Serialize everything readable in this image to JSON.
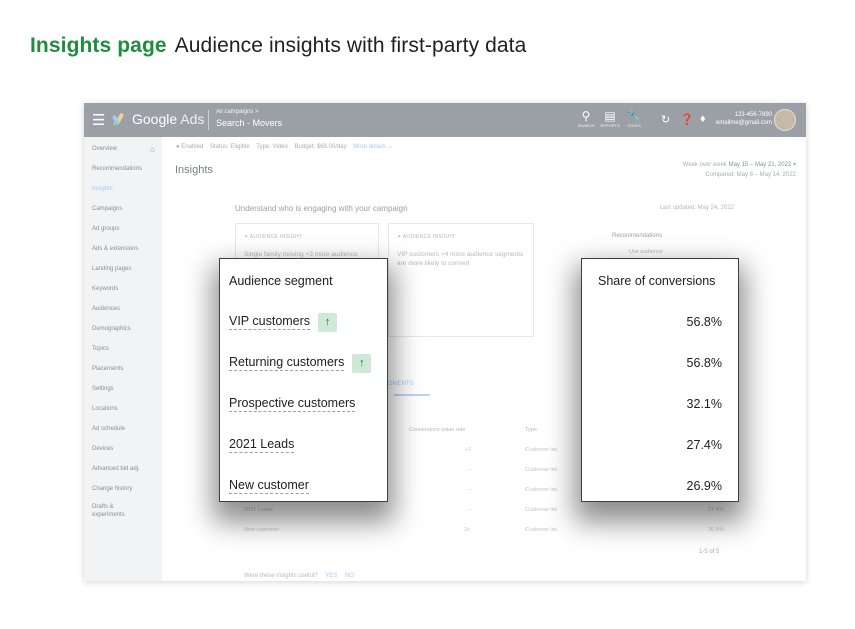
{
  "headline": {
    "title": "Insights page",
    "subtitle": "Audience insights with first-party data"
  },
  "topbar": {
    "brand_google": "Google",
    "brand_ads": "Ads",
    "breadcrumb": "All campaigns >",
    "campaign": "Search - Movers",
    "tools": [
      {
        "icon": "search-icon",
        "label": "SEARCH"
      },
      {
        "icon": "reports-icon",
        "label": "REPORTS"
      },
      {
        "icon": "wrench-icon",
        "label": "TOOLS"
      }
    ],
    "phone": "123-456-7890",
    "email": "emailme@gmail.com"
  },
  "sidebar": {
    "items": [
      {
        "label": "Overview"
      },
      {
        "label": "Recommendations"
      },
      {
        "label": "Insights"
      },
      {
        "label": "Campaigns"
      },
      {
        "label": "Ad groups"
      },
      {
        "label": "Ads & extensions"
      },
      {
        "label": "Landing pages"
      },
      {
        "label": "Keywords"
      },
      {
        "label": "Audiences"
      },
      {
        "label": "Demographics"
      },
      {
        "label": "Topics"
      },
      {
        "label": "Placements"
      },
      {
        "label": "Settings"
      },
      {
        "label": "Locations"
      },
      {
        "label": "Ad schedule"
      },
      {
        "label": "Devices"
      },
      {
        "label": "Advanced bid adj."
      },
      {
        "label": "Change history"
      },
      {
        "label": "Drafts & experiments"
      }
    ]
  },
  "status": {
    "enabled": "Enabled",
    "status": "Status: Eligible",
    "type": "Type: Video",
    "budget": "Budget: $68.00/day",
    "more": "More details"
  },
  "page_title": "Insights",
  "daterange": {
    "label": "Week over week",
    "range": "May 15 – May 21, 2022",
    "compared": "Compared: May 8 – May 14, 2022"
  },
  "understand": "Understand who is engaging with your campaign",
  "updated": "Last updated: May 24, 2022",
  "insight_cards": [
    {
      "kicker": "AUDIENCE INSIGHT",
      "text": "Single family moving +3 more audience"
    },
    {
      "kicker": "AUDIENCE INSIGHT",
      "text": "VIP customers +4 more audience segments are more likely to convert"
    }
  ],
  "recommendations": {
    "title": "Recommendations",
    "item": "Use audience"
  },
  "tab_label": "SEGMENTS",
  "table_headers": {
    "value_rate": "Conversions value rate",
    "type": "Type"
  },
  "bg_rows": [
    {
      "rate": "+1",
      "type": "Customer list"
    },
    {
      "rate": "–",
      "type": "Customer list"
    },
    {
      "rate": "–",
      "type": "Customer list"
    },
    {
      "name": "2021 Leads",
      "rate": "–",
      "type": "Customer list",
      "share": "27.4%"
    },
    {
      "name": "New customer",
      "rate": "2x",
      "type": "Customer list",
      "share": "26.9%"
    }
  ],
  "paging": "1-5 of 5",
  "feedback": {
    "question": "Were these insights useful?",
    "yes": "YES",
    "no": "NO"
  },
  "segment_panel": {
    "header": "Audience segment",
    "rows": [
      {
        "name": "VIP customers",
        "trend_up": true
      },
      {
        "name": "Returning customers",
        "trend_up": true
      },
      {
        "name": "Prospective customers",
        "trend_up": false
      },
      {
        "name": "2021 Leads",
        "trend_up": false
      },
      {
        "name": "New customer",
        "trend_up": false
      }
    ]
  },
  "share_panel": {
    "header": "Share of conversions",
    "values": [
      "56.8%",
      "56.8%",
      "32.1%",
      "27.4%",
      "26.9%"
    ]
  },
  "colors": {
    "accent_green": "#1e8e3e",
    "badge_bg": "#ceead6",
    "badge_fg": "#137333",
    "topbar": "#9aa0a6"
  }
}
